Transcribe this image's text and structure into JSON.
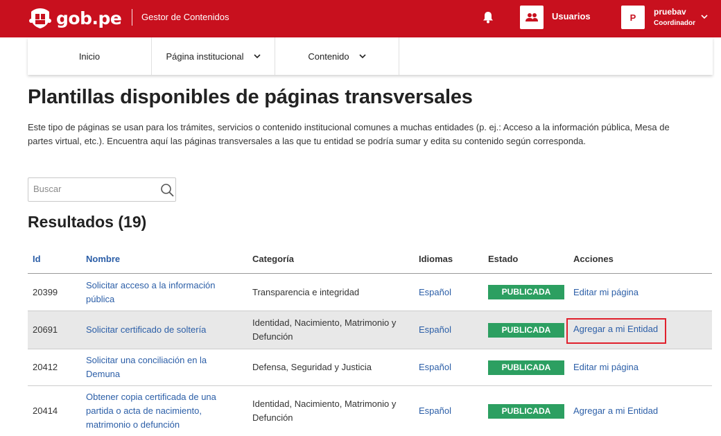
{
  "header": {
    "brand": "gob.pe",
    "app_title": "Gestor de Contenidos",
    "users_label": "Usuarios",
    "user": {
      "initial": "P",
      "name": "pruebav",
      "role": "Coordinador"
    }
  },
  "nav": {
    "items": [
      {
        "label": "Inicio"
      },
      {
        "label": "Página institucional"
      },
      {
        "label": "Contenido"
      }
    ]
  },
  "main": {
    "title": "Plantillas disponibles de páginas transversales",
    "intro": "Este tipo de páginas se usan para los trámites, servicios o contenido institucional comunes a muchas entidades (p. ej.: Acceso a la información pública, Mesa de partes virtual, etc.). Encuentra aquí las páginas transversales a las que tu entidad se podría sumar y edita su contenido según corresponda.",
    "search": {
      "placeholder": "Buscar",
      "value": ""
    },
    "results_title": "Resultados (19)"
  },
  "table": {
    "headers": [
      "Id",
      "Nombre",
      "Categoría",
      "Idiomas",
      "Estado",
      "Acciones"
    ],
    "rows": [
      {
        "id": "20399",
        "name": "Solicitar acceso a la información pública",
        "category": "Transparencia e integridad",
        "language": "Español",
        "status": "PUBLICADA",
        "action": "Editar mi página"
      },
      {
        "id": "20691",
        "name": "Solicitar certificado de soltería",
        "category": "Identidad, Nacimiento, Matrimonio y Defunción",
        "language": "Español",
        "status": "PUBLICADA",
        "action": "Agregar a mi Entidad"
      },
      {
        "id": "20412",
        "name": "Solicitar una conciliación en la Demuna",
        "category": "Defensa, Seguridad y Justicia",
        "language": "Español",
        "status": "PUBLICADA",
        "action": "Editar mi página"
      },
      {
        "id": "20414",
        "name": "Obtener copia certificada de una partida o acta de nacimiento, matrimonio o defunción",
        "category": "Identidad, Nacimiento, Matrimonio y Defunción",
        "language": "Español",
        "status": "PUBLICADA",
        "action": "Agregar a mi Entidad"
      }
    ]
  },
  "colors": {
    "brand_red": "#c8101e",
    "link_blue": "#2b5ea7",
    "status_green": "#2c9f61",
    "highlight_red": "#e0202c"
  }
}
